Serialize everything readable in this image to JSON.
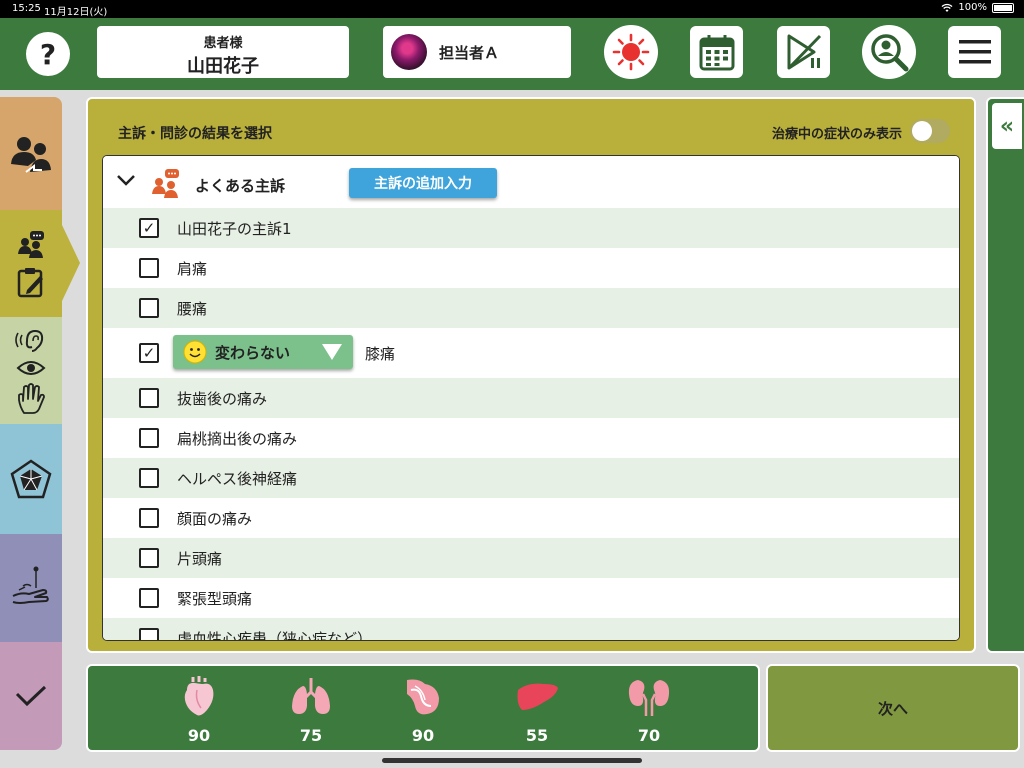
{
  "status_bar": {
    "time": "15:25",
    "date": "11月12日(火)",
    "battery": "100%"
  },
  "header": {
    "help_label": "?",
    "patient_label": "患者様",
    "patient_name": "山田花子",
    "staff_name": "担当者Ａ",
    "icons": [
      "sun-icon",
      "calendar-icon",
      "progress-icon",
      "search-user-icon",
      "menu-icon"
    ]
  },
  "left_rail": {
    "items": [
      "handover-icon",
      "interview-icon",
      "sensory-icon",
      "radar-icon",
      "acupuncture-icon",
      "check-icon"
    ]
  },
  "panel": {
    "title": "主訴・問診の結果を選択",
    "toggle_label": "治療中の症状のみ表示",
    "toggle_on": false,
    "group_label": "よくある主訴",
    "add_button": "主訴の追加入力",
    "rows": [
      {
        "label": "山田花子の主訴1",
        "checked": true
      },
      {
        "label": "肩痛",
        "checked": false
      },
      {
        "label": "腰痛",
        "checked": false
      },
      {
        "label": "膝痛",
        "checked": true,
        "status": "変わらない"
      },
      {
        "label": "抜歯後の痛み",
        "checked": false
      },
      {
        "label": "扁桃摘出後の痛み",
        "checked": false
      },
      {
        "label": "ヘルペス後神経痛",
        "checked": false
      },
      {
        "label": "顔面の痛み",
        "checked": false
      },
      {
        "label": "片頭痛",
        "checked": false
      },
      {
        "label": "緊張型頭痛",
        "checked": false
      },
      {
        "label": "虚血性心疾患（狭心症など）",
        "checked": false
      }
    ],
    "check_mark": "✓"
  },
  "side_panel": {
    "collapse_label": "«"
  },
  "vitals": [
    {
      "icon": "heart-icon",
      "value": "90",
      "color": "#f7c6d3"
    },
    {
      "icon": "lungs-icon",
      "value": "75",
      "color": "#f4a7b4"
    },
    {
      "icon": "stomach-icon",
      "value": "90",
      "color": "#f29aa8"
    },
    {
      "icon": "liver-icon",
      "value": "55",
      "color": "#e8455a"
    },
    {
      "icon": "kidney-icon",
      "value": "70",
      "color": "#f29aa8"
    }
  ],
  "next_button": "次へ"
}
